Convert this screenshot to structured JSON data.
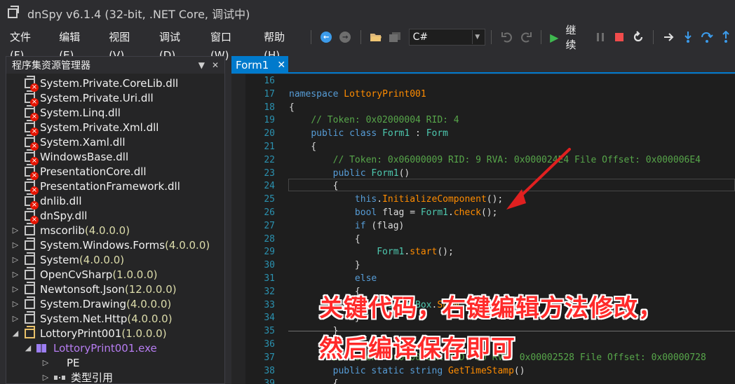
{
  "window": {
    "title": "dnSpy v6.1.4 (32-bit, .NET Core, 调试中)"
  },
  "menu": [
    "文件(F)",
    "编辑(E)",
    "视图(V)",
    "调试(D)",
    "窗口(W)",
    "帮助(H)"
  ],
  "toolbar": {
    "language": "C#",
    "continue_label": "继续"
  },
  "assembly_explorer": {
    "title": "程序集资源管理器",
    "items": [
      {
        "name": "System.Private.CoreLib.dll",
        "version": "",
        "state": "broken"
      },
      {
        "name": "System.Private.Uri.dll",
        "version": "",
        "state": "broken"
      },
      {
        "name": "System.Linq.dll",
        "version": "",
        "state": "broken"
      },
      {
        "name": "System.Private.Xml.dll",
        "version": "",
        "state": "broken"
      },
      {
        "name": "System.Xaml.dll",
        "version": "",
        "state": "broken"
      },
      {
        "name": "WindowsBase.dll",
        "version": "",
        "state": "broken"
      },
      {
        "name": "PresentationCore.dll",
        "version": "",
        "state": "broken"
      },
      {
        "name": "PresentationFramework.dll",
        "version": "",
        "state": "broken"
      },
      {
        "name": "dnlib.dll",
        "version": "",
        "state": "broken"
      },
      {
        "name": "dnSpy.dll",
        "version": "",
        "state": "broken"
      },
      {
        "name": "mscorlib",
        "version": "(4.0.0.0)",
        "state": "collapsed"
      },
      {
        "name": "System.Windows.Forms",
        "version": "(4.0.0.0)",
        "state": "collapsed"
      },
      {
        "name": "System",
        "version": "(4.0.0.0)",
        "state": "collapsed"
      },
      {
        "name": "OpenCvSharp",
        "version": "(1.0.0.0)",
        "state": "collapsed"
      },
      {
        "name": "Newtonsoft.Json",
        "version": "(12.0.0.0)",
        "state": "collapsed"
      },
      {
        "name": "System.Drawing",
        "version": "(4.0.0.0)",
        "state": "collapsed"
      },
      {
        "name": "System.Net.Http",
        "version": "(4.0.0.0)",
        "state": "collapsed"
      },
      {
        "name": "LottoryPrint001",
        "version": "(1.0.0.0)",
        "state": "expanded"
      }
    ],
    "module": "LottoryPrint001.exe",
    "children": [
      "PE",
      "类型引用"
    ]
  },
  "editor": {
    "tab": "Form1",
    "lines": [
      {
        "n": "16",
        "t": []
      },
      {
        "n": "17",
        "t": [
          [
            "kw",
            "namespace "
          ],
          [
            "md",
            "LottoryPrint001"
          ]
        ]
      },
      {
        "n": "18",
        "t": [
          [
            "pl",
            "{"
          ]
        ]
      },
      {
        "n": "19",
        "t": [
          [
            "pl",
            "    "
          ],
          [
            "cm",
            "// Token: 0x02000004 RID: 4"
          ]
        ]
      },
      {
        "n": "20",
        "t": [
          [
            "pl",
            "    "
          ],
          [
            "kw",
            "public class "
          ],
          [
            "ty",
            "Form1"
          ],
          [
            "pl",
            " : "
          ],
          [
            "ty",
            "Form"
          ]
        ]
      },
      {
        "n": "21",
        "t": [
          [
            "pl",
            "    {"
          ]
        ]
      },
      {
        "n": "22",
        "t": [
          [
            "pl",
            "        "
          ],
          [
            "cm",
            "// Token: 0x06000009 RID: 9 RVA: 0x000024E4 File Offset: 0x000006E4"
          ]
        ]
      },
      {
        "n": "23",
        "t": [
          [
            "pl",
            "        "
          ],
          [
            "kw",
            "public "
          ],
          [
            "ty",
            "Form1"
          ],
          [
            "pl",
            "()"
          ]
        ]
      },
      {
        "n": "24",
        "t": [
          [
            "pl",
            "        {"
          ]
        ]
      },
      {
        "n": "25",
        "t": [
          [
            "pl",
            "            "
          ],
          [
            "kw",
            "this"
          ],
          [
            "pl",
            "."
          ],
          [
            "md",
            "InitializeComponent"
          ],
          [
            "pl",
            "();"
          ]
        ]
      },
      {
        "n": "26",
        "t": [
          [
            "pl",
            "            "
          ],
          [
            "kw",
            "bool "
          ],
          [
            "pl",
            "flag = "
          ],
          [
            "ty",
            "Form1"
          ],
          [
            "pl",
            "."
          ],
          [
            "md",
            "check"
          ],
          [
            "pl",
            "();"
          ]
        ]
      },
      {
        "n": "27",
        "t": [
          [
            "pl",
            "            "
          ],
          [
            "kw",
            "if "
          ],
          [
            "pl",
            "(flag)"
          ]
        ]
      },
      {
        "n": "28",
        "t": [
          [
            "pl",
            "            {"
          ]
        ]
      },
      {
        "n": "29",
        "t": [
          [
            "pl",
            "                "
          ],
          [
            "ty",
            "Form1"
          ],
          [
            "pl",
            "."
          ],
          [
            "md",
            "start"
          ],
          [
            "pl",
            "();"
          ]
        ]
      },
      {
        "n": "30",
        "t": [
          [
            "pl",
            "            }"
          ]
        ]
      },
      {
        "n": "31",
        "t": [
          [
            "pl",
            "            "
          ],
          [
            "kw",
            "else"
          ]
        ]
      },
      {
        "n": "32",
        "t": [
          [
            "pl",
            "            {"
          ]
        ]
      },
      {
        "n": "33",
        "t": [
          [
            "pl",
            "                "
          ],
          [
            "ty",
            "MessageBox"
          ],
          [
            "pl",
            "."
          ],
          [
            "md",
            "Show"
          ]
        ]
      },
      {
        "n": "34",
        "t": [
          [
            "pl",
            "            }"
          ]
        ]
      },
      {
        "n": "35",
        "t": [
          [
            "pl",
            "        }"
          ]
        ]
      },
      {
        "n": "36",
        "t": []
      },
      {
        "n": "37",
        "t": [
          [
            "pl",
            "        "
          ],
          [
            "cm",
            "// Token: 0x0600000A RID: 10 RVA: 0x00002528 File Offset: 0x00000728"
          ]
        ]
      },
      {
        "n": "38",
        "t": [
          [
            "pl",
            "        "
          ],
          [
            "kw",
            "public static string "
          ],
          [
            "md",
            "GetTimeStamp"
          ],
          [
            "pl",
            "()"
          ]
        ]
      },
      {
        "n": "39",
        "t": [
          [
            "pl",
            "        {"
          ]
        ]
      }
    ]
  },
  "annotation": {
    "line1": "关键代码，右键编辑方法修改，",
    "line2": "然后编译保存即可",
    "color": "#ff2a2a"
  }
}
